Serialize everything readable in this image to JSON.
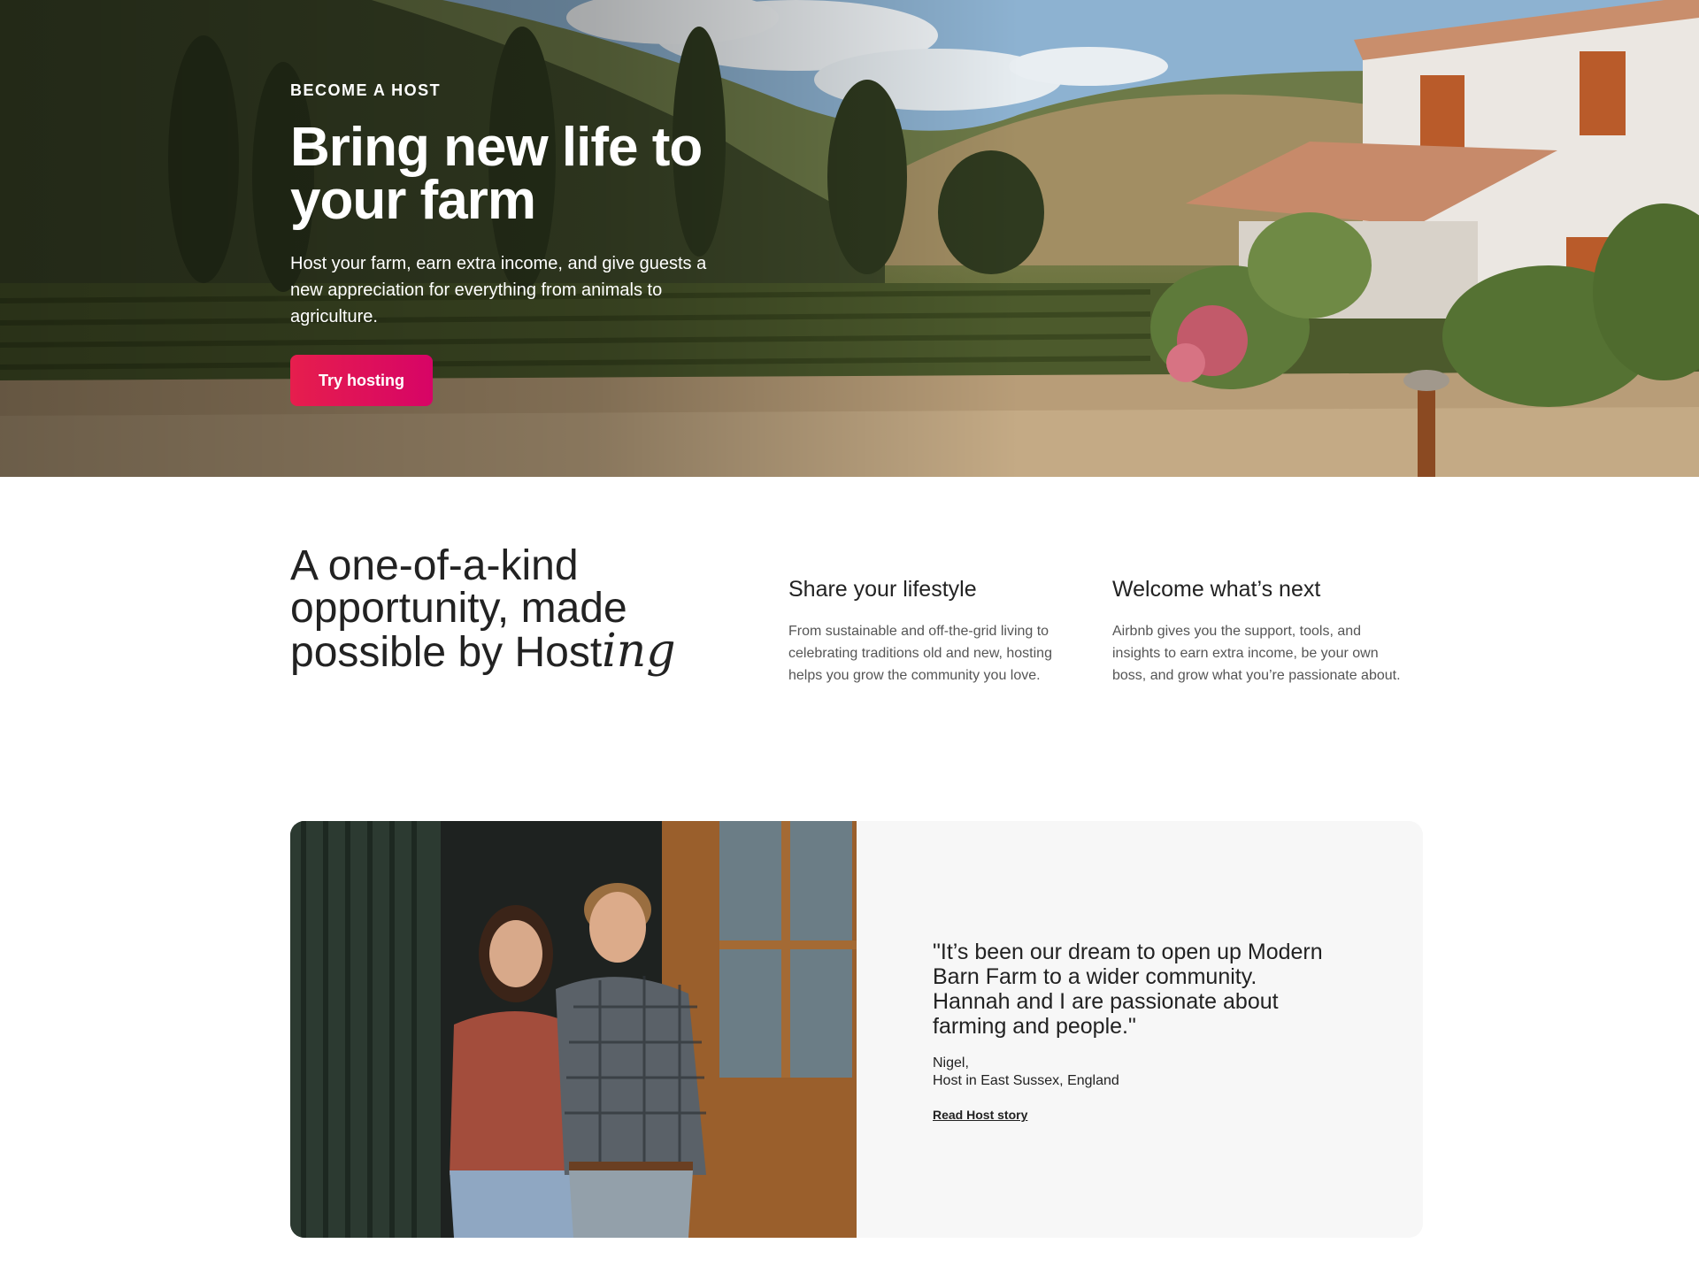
{
  "hero": {
    "eyebrow": "BECOME A HOST",
    "title": "Bring new life to your farm",
    "subtitle": "Host your farm, earn extra income, and give guests a new appreciation for everything from animals to agriculture.",
    "cta_label": "Try hosting",
    "cta_color": "#e61e4d"
  },
  "intro": {
    "heading_main": "A one-of-a-kind opportunity, made possible by Host",
    "heading_script": "ing",
    "features": [
      {
        "title": "Share your lifestyle",
        "body": "From sustainable and off-the-grid living to celebrating traditions old and new, hosting helps you grow the community you love."
      },
      {
        "title": "Welcome what’s next",
        "body": "Airbnb gives you the support, tools, and insights to earn extra income, be your own boss, and grow what you’re passionate about."
      }
    ]
  },
  "story": {
    "quote": "\"It’s been our dream to open up Modern Barn Farm to a wider community. Hannah and I are passionate about farming and people.\"",
    "author_name": "Nigel,",
    "author_location": "Host in East Sussex, England",
    "link_label": "Read Host story"
  }
}
